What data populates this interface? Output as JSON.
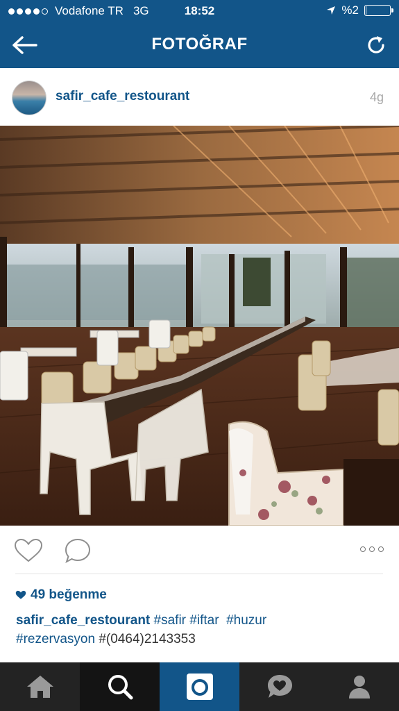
{
  "status_bar": {
    "carrier": "Vodafone TR",
    "network": "3G",
    "time": "18:52",
    "battery": "%2"
  },
  "nav": {
    "title": "FOTOĞRAF",
    "back_icon": "arrow-left-icon",
    "refresh_icon": "refresh-icon"
  },
  "post": {
    "username": "safir_cafe_restourant",
    "age": "4g",
    "likes": "49 beğenme",
    "caption": {
      "username": "safir_cafe_restourant",
      "tags": [
        "#safir",
        "#iftar",
        "#huzur",
        "#rezervasyon"
      ],
      "phone": "#(0464)2143353"
    }
  },
  "tabbar": {
    "items": [
      "home-icon",
      "search-icon",
      "camera-icon",
      "activity-icon",
      "profile-icon"
    ],
    "active": "camera-icon"
  },
  "colors": {
    "brand": "#125589",
    "tabbar": "#232323"
  }
}
